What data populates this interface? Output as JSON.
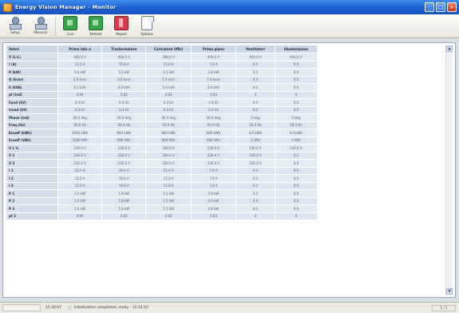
{
  "window": {
    "title": "Energy Vision Manager - Monitor"
  },
  "toolbar": {
    "buttons": [
      {
        "label": "Setup"
      },
      {
        "label": "Measure"
      },
      {
        "label": "Live"
      },
      {
        "label": "Refresh"
      },
      {
        "label": "Report"
      },
      {
        "label": "Options"
      }
    ]
  },
  "grid": {
    "headers": [
      "Valori",
      "Primo lato a",
      "Trasformatore",
      "Caricatore Uffici",
      "Primo piano",
      "Ventilatori",
      "Illuminazione"
    ],
    "rows": [
      {
        "label": "V (L-L)",
        "values": [
          "400.0 V",
          "400.0 V",
          "398.0 V",
          "400.0 V",
          "400.0 V",
          "400.0 V"
        ]
      },
      {
        "label": "I (A)",
        "values": [
          "12.0 A",
          "10.0 A",
          "11.0 A",
          "7.0 A",
          "0.0",
          "0.0"
        ]
      },
      {
        "label": "P (kW)",
        "values": [
          "6.0 kW",
          "5.5 kW",
          "4.5 kW",
          "2.8 kW",
          "0.0",
          "0.0"
        ]
      },
      {
        "label": "Q (kvar)",
        "values": [
          "2.0 kvar",
          "2.0 kvar",
          "1.5 kvar",
          "1.0 kvar",
          "0.0",
          "0.0"
        ]
      },
      {
        "label": "S (kVA)",
        "values": [
          "6.5 kVA",
          "6.0 kVA",
          "5.0 kVA",
          "3.0 kVA",
          "0.0",
          "0.0"
        ]
      },
      {
        "label": "pf (Ind)",
        "values": [
          "0.94",
          "0.92",
          "0.93",
          "0.93",
          "0",
          "0"
        ]
      },
      {
        "label": "Fund (kV)",
        "values": [
          "0.4 kV",
          "0.4 kV",
          "0.4 kV",
          "0.4 kV",
          "0.0",
          "0.0"
        ]
      },
      {
        "label": "Icond (kV)",
        "values": [
          "0.4 kV",
          "0.4 kV",
          "0.4 kV",
          "0.4 kV",
          "0.0",
          "0.0"
        ]
      },
      {
        "label": "Phase (ind)",
        "values": [
          "30.0 deg",
          "30.0 deg",
          "30.0 deg",
          "30.0 deg",
          "0 deg",
          "0 deg"
        ]
      },
      {
        "label": "Freq (Hz)",
        "values": [
          "50.0 Hz",
          "50.0 Hz",
          "50.0 Hz",
          "50.0 Hz",
          "50.0 Hz",
          "50.0 Hz"
        ]
      },
      {
        "label": "Ecoeff (kWh)",
        "values": [
          "1000 kWh",
          "900 kWh",
          "800 kWh",
          "600 kWh",
          "0.0 kWh",
          "0.0 kWh"
        ]
      },
      {
        "label": "Ecoeff (VAh)",
        "values": [
          "1000 VAh",
          "900 VAh",
          "800 VAh",
          "600 VAh",
          "0 VAh",
          "0 VAh"
        ]
      },
      {
        "label": "V L %",
        "values": [
          "230.0 V",
          "230.0 V",
          "230.0 V",
          "230.0 V",
          "230.0 V",
          "230.0 V"
        ]
      },
      {
        "label": "V 1",
        "values": [
          "230.0 V",
          "230.0 V",
          "230.0 V",
          "230.0 V",
          "230.0 V",
          "0.0"
        ]
      },
      {
        "label": "V 2",
        "values": [
          "230.0 V",
          "230.0 V",
          "230.0 V",
          "230.0 V",
          "230.0 V",
          "0.0"
        ]
      },
      {
        "label": "I 1",
        "values": [
          "12.0 A",
          "10.0 A",
          "11.0 A",
          "7.0 A",
          "0.0",
          "0.0"
        ]
      },
      {
        "label": "I 2",
        "values": [
          "12.0 A",
          "10.0 A",
          "11.0 A",
          "7.0 A",
          "0.0",
          "0.0"
        ]
      },
      {
        "label": "I 3",
        "values": [
          "12.0 A",
          "10.0 A",
          "11.0 A",
          "7.0 A",
          "0.0",
          "0.0"
        ]
      },
      {
        "label": "P 1",
        "values": [
          "2.0 kW",
          "1.8 kW",
          "1.5 kW",
          "0.9 kW",
          "0.0",
          "0.0"
        ]
      },
      {
        "label": "P 2",
        "values": [
          "2.0 kW",
          "1.8 kW",
          "1.5 kW",
          "0.9 kW",
          "0.0",
          "0.0"
        ]
      },
      {
        "label": "P 3",
        "values": [
          "2.0 kW",
          "1.8 kW",
          "1.5 kW",
          "0.9 kW",
          "0.0",
          "0.0"
        ]
      },
      {
        "label": "pf 3",
        "values": [
          "0.94",
          "0.92",
          "0.93",
          "0.93",
          "0",
          "0"
        ]
      }
    ]
  },
  "status": {
    "time": "15:30:07",
    "message": "Initialization completed, ready - 15:31:10",
    "right": "1 / 1"
  }
}
